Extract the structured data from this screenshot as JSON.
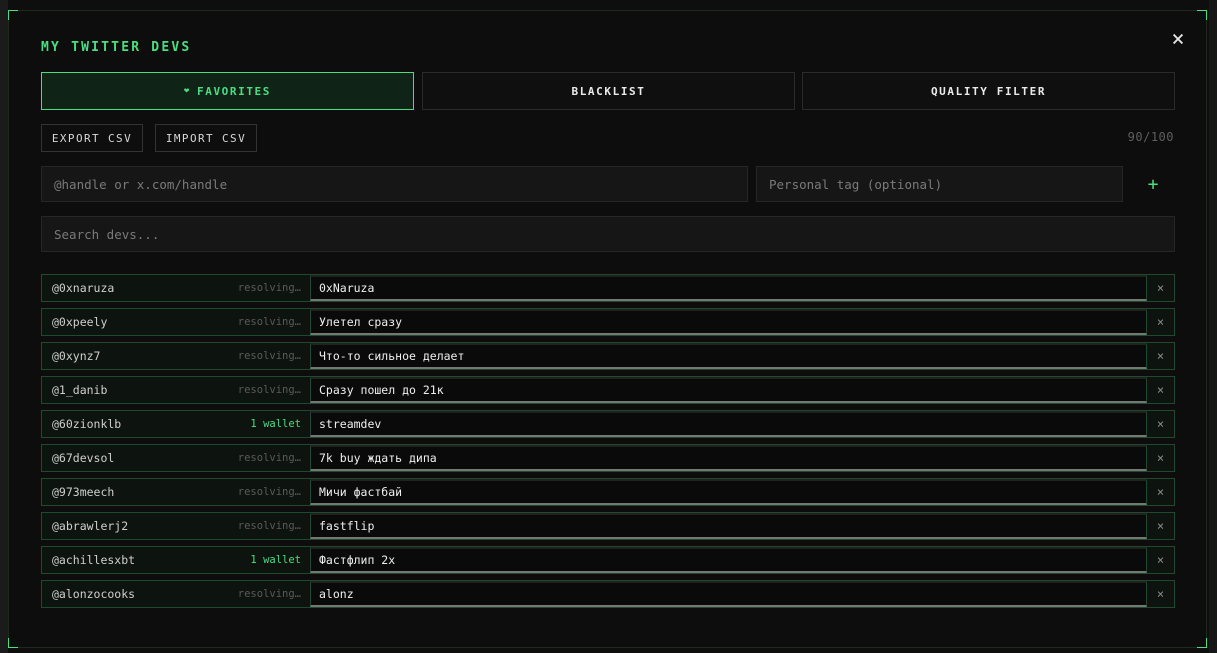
{
  "title": "MY TWITTER DEVS",
  "close_symbol": "×",
  "tabs": [
    {
      "label": "FAVORITES",
      "icon": "heart-icon",
      "glyph": "❤"
    },
    {
      "label": "BLACKLIST"
    },
    {
      "label": "QUALITY FILTER"
    }
  ],
  "actions": {
    "export_label": "EXPORT CSV",
    "import_label": "IMPORT CSV",
    "counter": "90/100"
  },
  "add_form": {
    "handle_placeholder": "@handle or x.com/handle",
    "tag_placeholder": "Personal tag (optional)",
    "add_symbol": "+"
  },
  "search": {
    "placeholder": "Search devs..."
  },
  "remove_symbol": "×",
  "colors": {
    "accent": "#4ade80",
    "background": "#0d0d0d",
    "row_border": "#1f4a2c"
  },
  "devs": [
    {
      "handle": "@0xnaruza",
      "status": "resolving…",
      "tag": "0xNaruza"
    },
    {
      "handle": "@0xpeely",
      "status": "resolving…",
      "tag": "Улетел сразу"
    },
    {
      "handle": "@0xynz7",
      "status": "resolving…",
      "tag": "Что-то сильное делает"
    },
    {
      "handle": "@1_danib",
      "status": "resolving…",
      "tag": "Сразу пошел до 21к"
    },
    {
      "handle": "@60zionklb",
      "status": "1 wallet",
      "tag": "streamdev"
    },
    {
      "handle": "@67devsol",
      "status": "resolving…",
      "tag": "7k buy ждать дипа"
    },
    {
      "handle": "@973meech",
      "status": "resolving…",
      "tag": "Мичи фастбай"
    },
    {
      "handle": "@abrawlerj2",
      "status": "resolving…",
      "tag": "fastflip"
    },
    {
      "handle": "@achillesxbt",
      "status": "1 wallet",
      "tag": "Фастфлип 2x"
    },
    {
      "handle": "@alonzocooks",
      "status": "resolving…",
      "tag": "alonz"
    }
  ]
}
